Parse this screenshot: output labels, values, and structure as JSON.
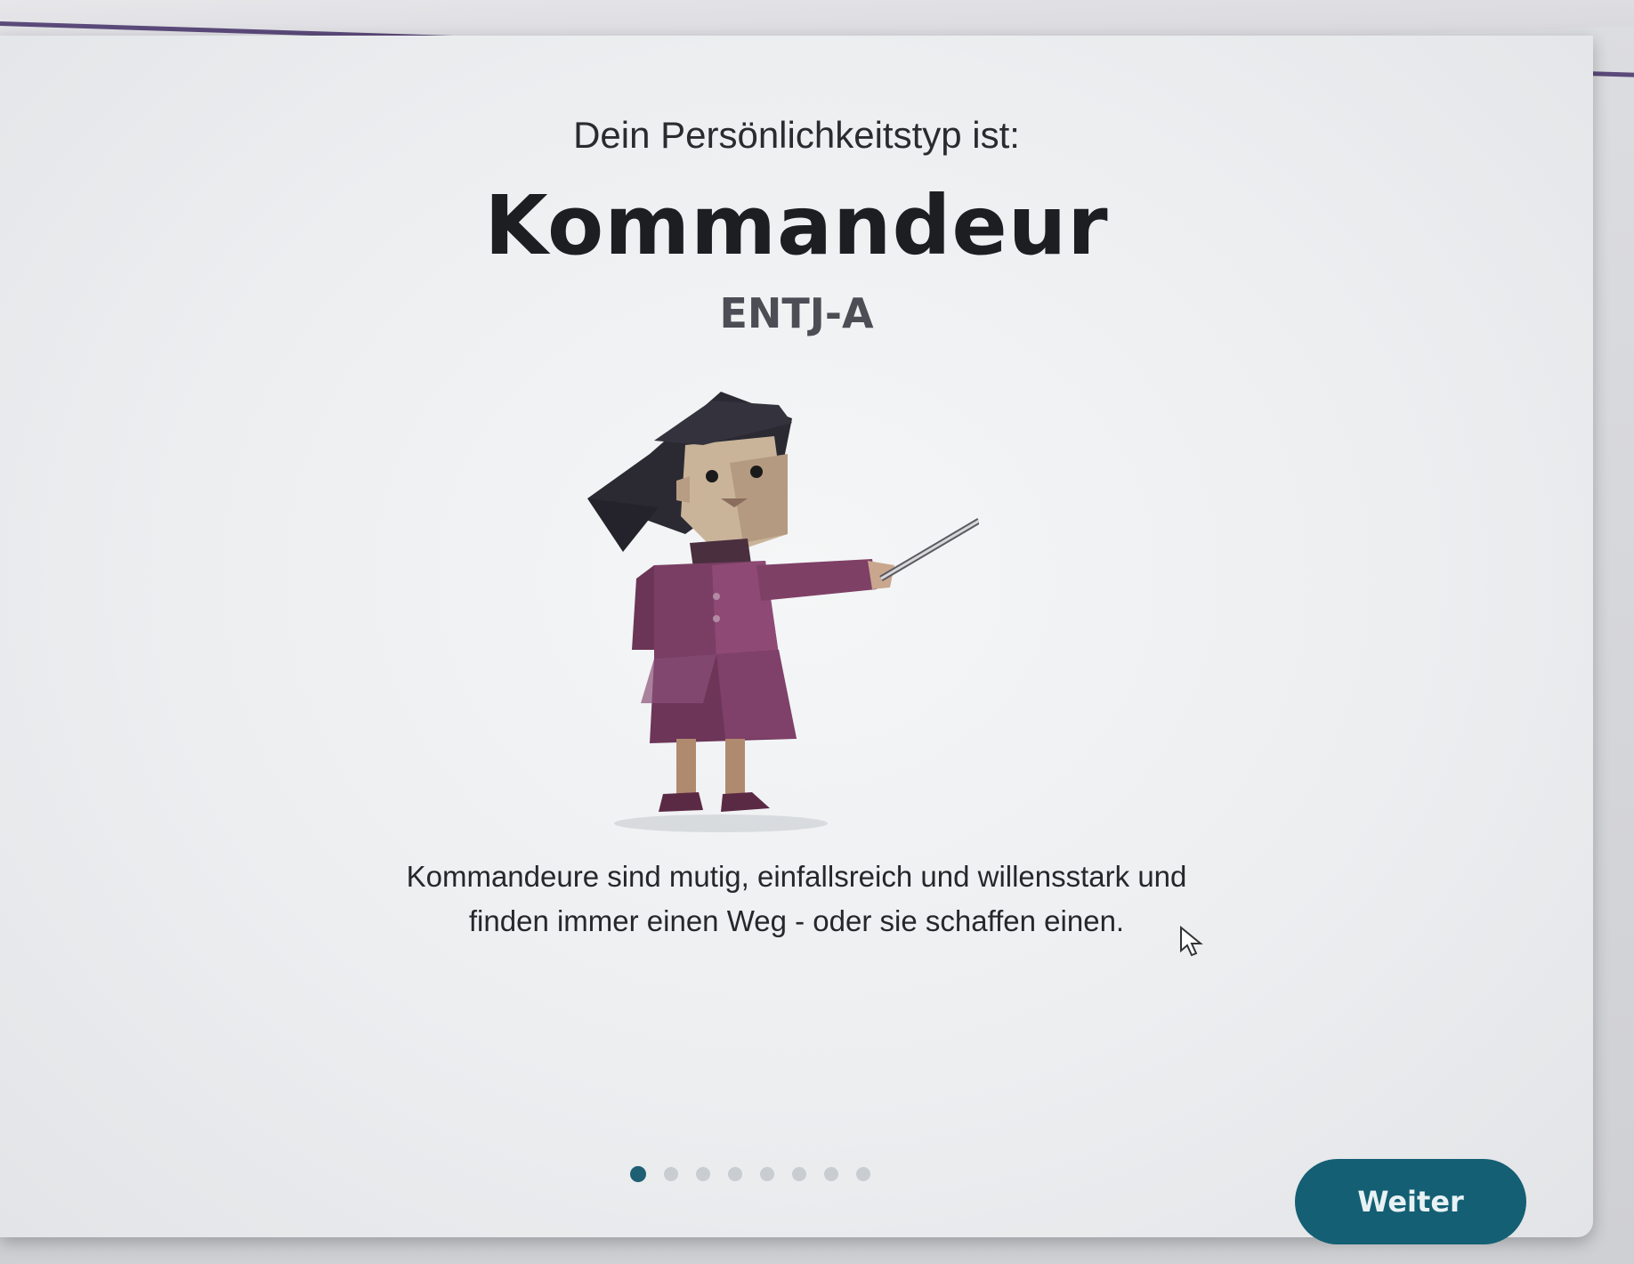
{
  "result": {
    "intro": "Dein Persönlichkeitstyp ist:",
    "type_name": "Kommandeur",
    "type_code": "ENTJ-A",
    "description_line1": "Kommandeure sind mutig, einfallsreich und willensstark und",
    "description_line2": "finden immer einen Weg - oder sie schaffen einen."
  },
  "illustration": {
    "icon": "commander-character-illustration"
  },
  "pager": {
    "total": 8,
    "current": 1
  },
  "actions": {
    "next_label": "Weiter"
  },
  "colors": {
    "accent": "#145f73",
    "top_stripe": "#5b4a7a"
  }
}
